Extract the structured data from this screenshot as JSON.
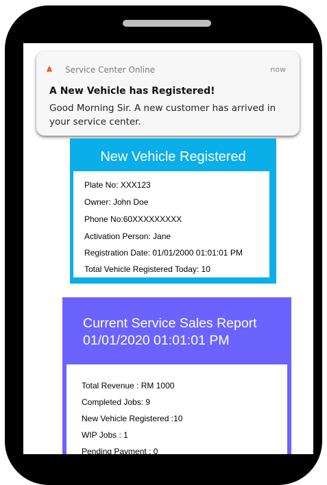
{
  "colors": {
    "frame": "#000000",
    "speaker": "#bfbfbf",
    "vehicle_card": "#0aaee8",
    "sales_card": "#6c63ff",
    "app_icon": "#f25c2a"
  },
  "notification": {
    "icon": "bell-icon",
    "app_name": "Service Center Online",
    "time": "now",
    "title": "A New Vehicle has Registered!",
    "body": "Good Morning Sir. A new customer has arrived in your service center."
  },
  "vehicle_card": {
    "title": "New Vehicle Registered",
    "lines": [
      "Plate No: XXX123",
      "Owner: John Doe",
      "Phone No:60XXXXXXXXX",
      "Activation Person: Jane",
      "Registration Date: 01/01/2000 01:01:01 PM",
      "Total Vehicle Registered Today: 10"
    ]
  },
  "sales_card": {
    "title_line1": "Current Service Sales Report",
    "title_line2": "01/01/2020 01:01:01 PM",
    "lines": [
      "Total Revenue : RM 1000",
      "Completed Jobs: 9",
      "New Vehicle Registered :10",
      "WIP Jobs : 1",
      "Pending Payment : 0"
    ]
  }
}
